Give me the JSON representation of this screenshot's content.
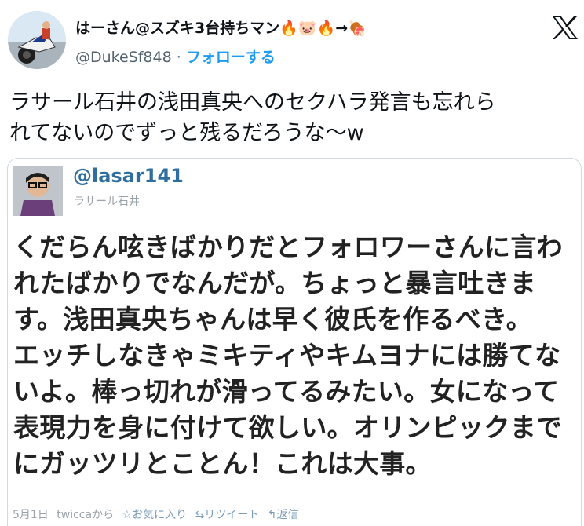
{
  "author": {
    "name": "はーさん@スズキ3台持ちマン🔥🐷🔥→🍖",
    "handle": "@DukeSf848",
    "separator": "·",
    "follow_label": "フォローする"
  },
  "tweet": {
    "text": "ラサール石井の浅田真央へのセクハラ発言も忘れら\nれてないのでずっと残るだろうな〜w"
  },
  "embedded": {
    "handle": "@lasar141",
    "name": "ラサール石井",
    "body": "くだらん呟きばかりだとフォロワーさんに言わ\nれたばかりでなんだが。ちょっと暴言吐きま\nす。浅田真央ちゃんは早く彼氏を作るべき。\nエッチしなきゃミキティやキムヨナには勝てな\nいよ。棒っ切れが滑ってるみたい。女になって\n表現力を身に付けて欲しい。オリンピックまで\nにガッツリとことん！これは大事。",
    "date": "5月1日",
    "via": "twiccaから",
    "favorite": "☆お気に入り",
    "retweet": "⇆リツイート",
    "reply": "↰返信"
  },
  "colors": {
    "follow": "#1d9bf0",
    "embed_handle": "#2f6f9f",
    "muted": "#536471"
  },
  "icons": [
    "x-logo-icon",
    "fire-icon",
    "pig-icon",
    "meat-icon"
  ]
}
